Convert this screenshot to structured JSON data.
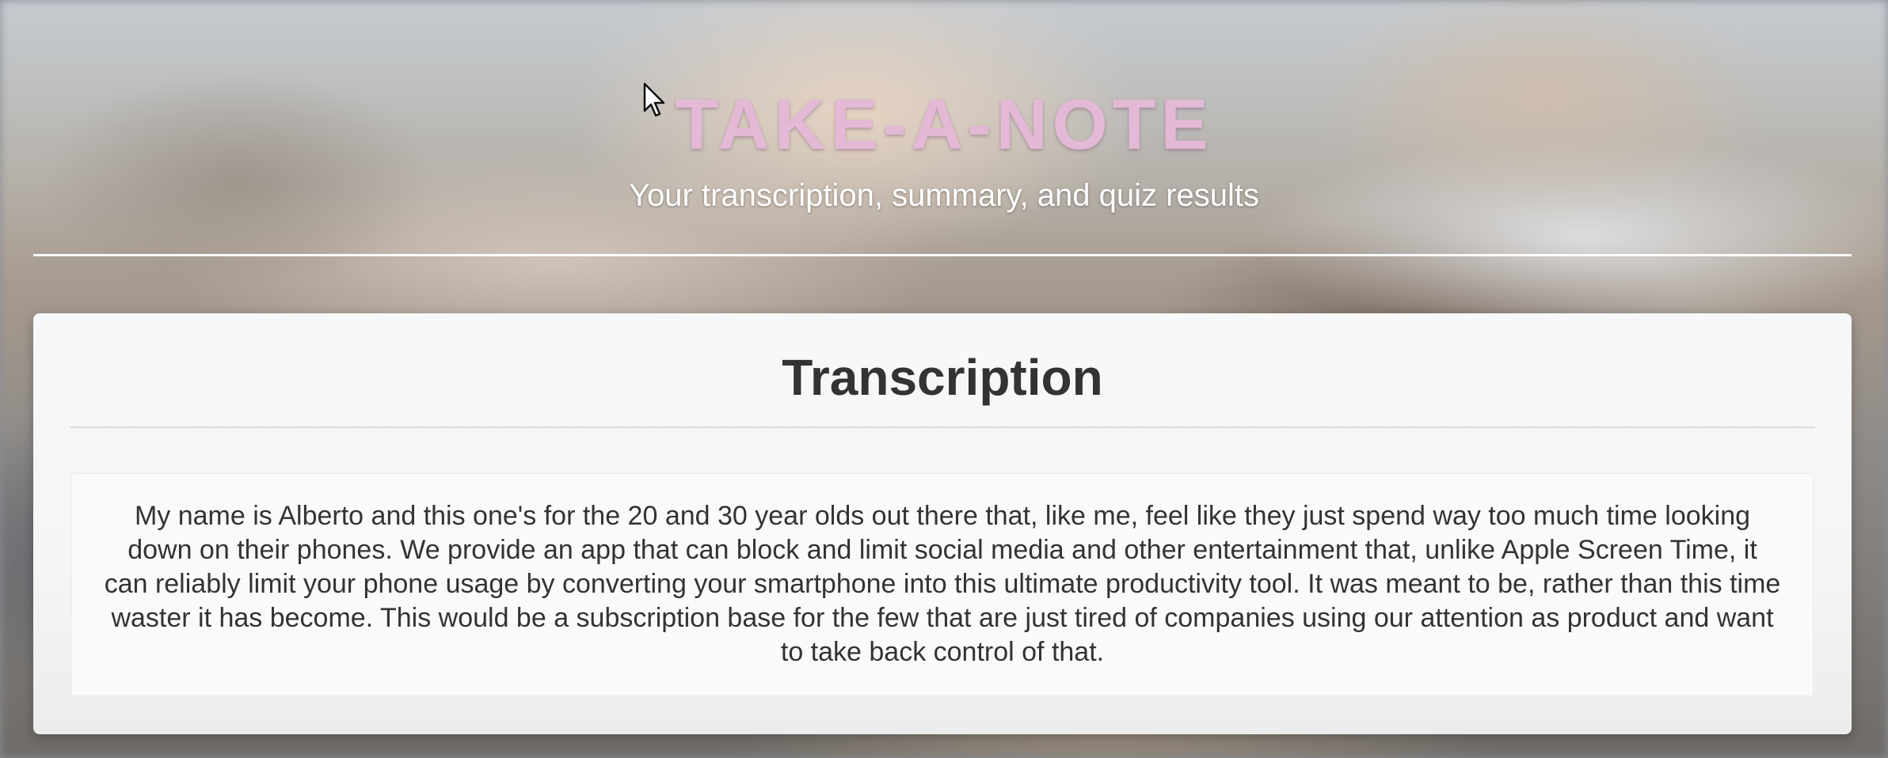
{
  "header": {
    "title": "TAKE-A-NOTE",
    "subtitle": "Your transcription, summary, and quiz results"
  },
  "transcription_card": {
    "heading": "Transcription",
    "text": "My name is Alberto and this one's for the 20 and 30 year olds out there that, like me, feel like they just spend way too much time looking down on their phones. We provide an app that can block and limit social media and other entertainment that, unlike Apple Screen Time, it can reliably limit your phone usage by converting your smartphone into this ultimate productivity tool. It was meant to be, rather than this time waster it has become. This would be a subscription base for the few that are just tired of companies using our attention as product and want to take back control of that."
  },
  "colors": {
    "title": "#e3b9d6",
    "subtitle": "#ffffff",
    "card_background": "#f5f5f5",
    "text": "#333333"
  },
  "icons": {
    "cursor": "mouse-pointer-icon"
  }
}
